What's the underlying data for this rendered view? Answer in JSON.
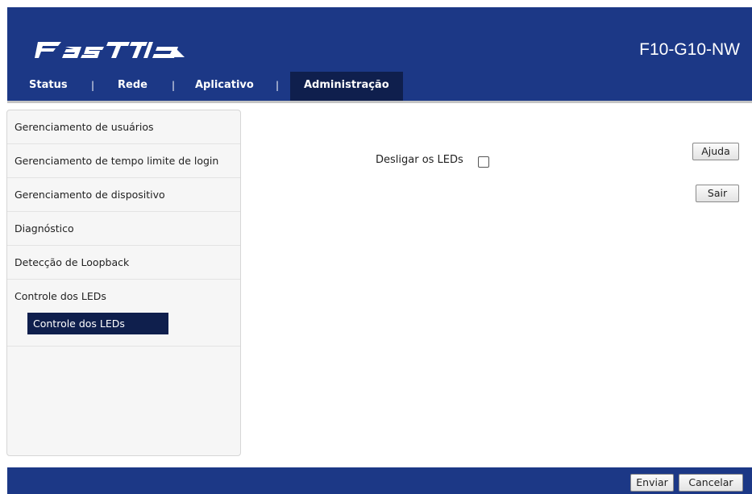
{
  "header": {
    "logo_text": "FASTTIO",
    "model": "F10-G10-NW"
  },
  "nav": {
    "items": [
      "Status",
      "Rede",
      "Aplicativo",
      "Administração"
    ],
    "separator": "|",
    "active": "Administração"
  },
  "sidebar": {
    "items": [
      "Gerenciamento de usuários",
      "Gerenciamento de tempo limite de login",
      "Gerenciamento de dispositivo",
      "Diagnóstico",
      "Detecção de Loopback"
    ],
    "group_title": "Controle dos LEDs",
    "sub_item": "Controle dos LEDs"
  },
  "main": {
    "led_off_label": "Desligar os LEDs",
    "led_off_checked": false,
    "help_button": "Ajuda",
    "exit_button": "Sair"
  },
  "footer": {
    "submit_button": "Enviar",
    "cancel_button": "Cancelar"
  },
  "colors": {
    "header_blue": "#1c3886",
    "active_navy": "#0f1f4d"
  }
}
